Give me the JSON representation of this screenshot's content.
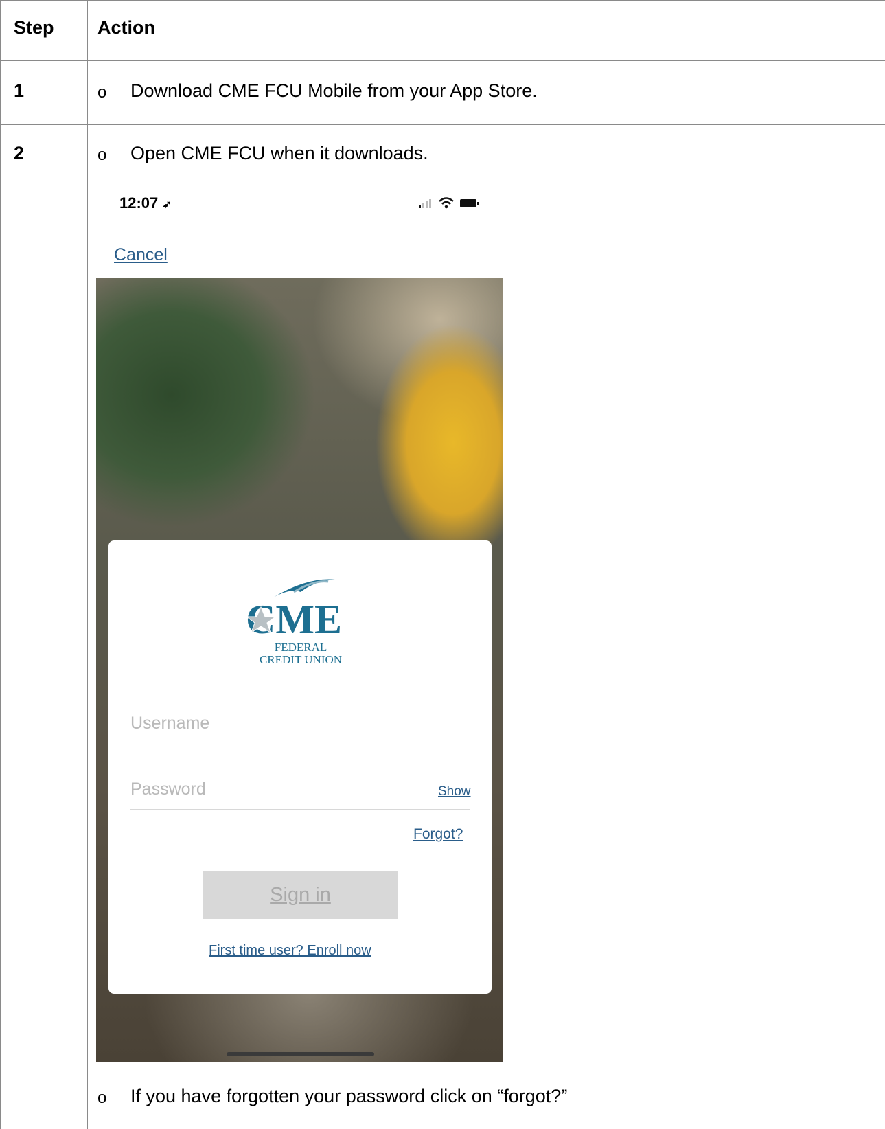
{
  "table": {
    "header": {
      "step": "Step",
      "action": "Action"
    },
    "rows": [
      {
        "step": "1",
        "bullet": "o",
        "text": "Download CME FCU Mobile from your App Store."
      },
      {
        "step": "2",
        "bullet": "o",
        "text": "Open CME FCU when it downloads."
      }
    ],
    "footer_bullet": "o",
    "footer_text": "If you have forgotten your password click on “forgot?”"
  },
  "phone": {
    "status": {
      "time": "12:07"
    },
    "cancel": "Cancel",
    "logo": {
      "mark": "CME",
      "line1": "FEDERAL",
      "line2": "CREDIT UNION"
    },
    "username_placeholder": "Username",
    "password_placeholder": "Password",
    "show": "Show",
    "forgot": "Forgot?",
    "signin": "Sign in",
    "enroll": "First time user? Enroll now",
    "colors": {
      "link": "#2a5d8a",
      "brand": "#1d6f91"
    }
  }
}
